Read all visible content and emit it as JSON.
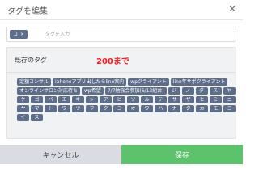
{
  "dialog": {
    "title": "タグを編集",
    "close_symbol": "✕"
  },
  "input": {
    "chip_label": "コ",
    "chip_remove": "×",
    "placeholder": "タグを入力"
  },
  "existing": {
    "title": "既存のタグ",
    "note": "200まで",
    "tags": [
      "定額コンサル",
      "iphoneアプリ出したらline案内",
      "wpクライアント",
      "line年サポクライアント",
      "オンラインサロン対応待ち",
      "wp希望",
      "7/7勉強会参加(6/13組台)",
      "ジ",
      "ノ",
      "ダ",
      "ス",
      "ヤ",
      "ケ",
      "ゴ",
      "バ",
      "エ",
      "キ",
      "シ",
      "ア",
      "ビ",
      "ソ",
      "ル",
      "テ",
      "サ",
      "ザ",
      "ヒ",
      "ミ",
      "ニ",
      "ヤ",
      "マ",
      "ト",
      "ワ",
      "ツ",
      "フ",
      "ク",
      "ヨ",
      "オ",
      "ワ",
      "ハ",
      "ナ",
      "タ",
      "カ",
      "モ",
      "コ",
      "イ",
      "ス"
    ]
  },
  "footer": {
    "cancel_label": "キャンセル",
    "save_label": "保存"
  },
  "colors": {
    "tag_bg": "#5e6e8a",
    "save_bg": "#5cc26b",
    "cancel_bg": "#d9dde2",
    "note_red": "#ff1a1a"
  }
}
